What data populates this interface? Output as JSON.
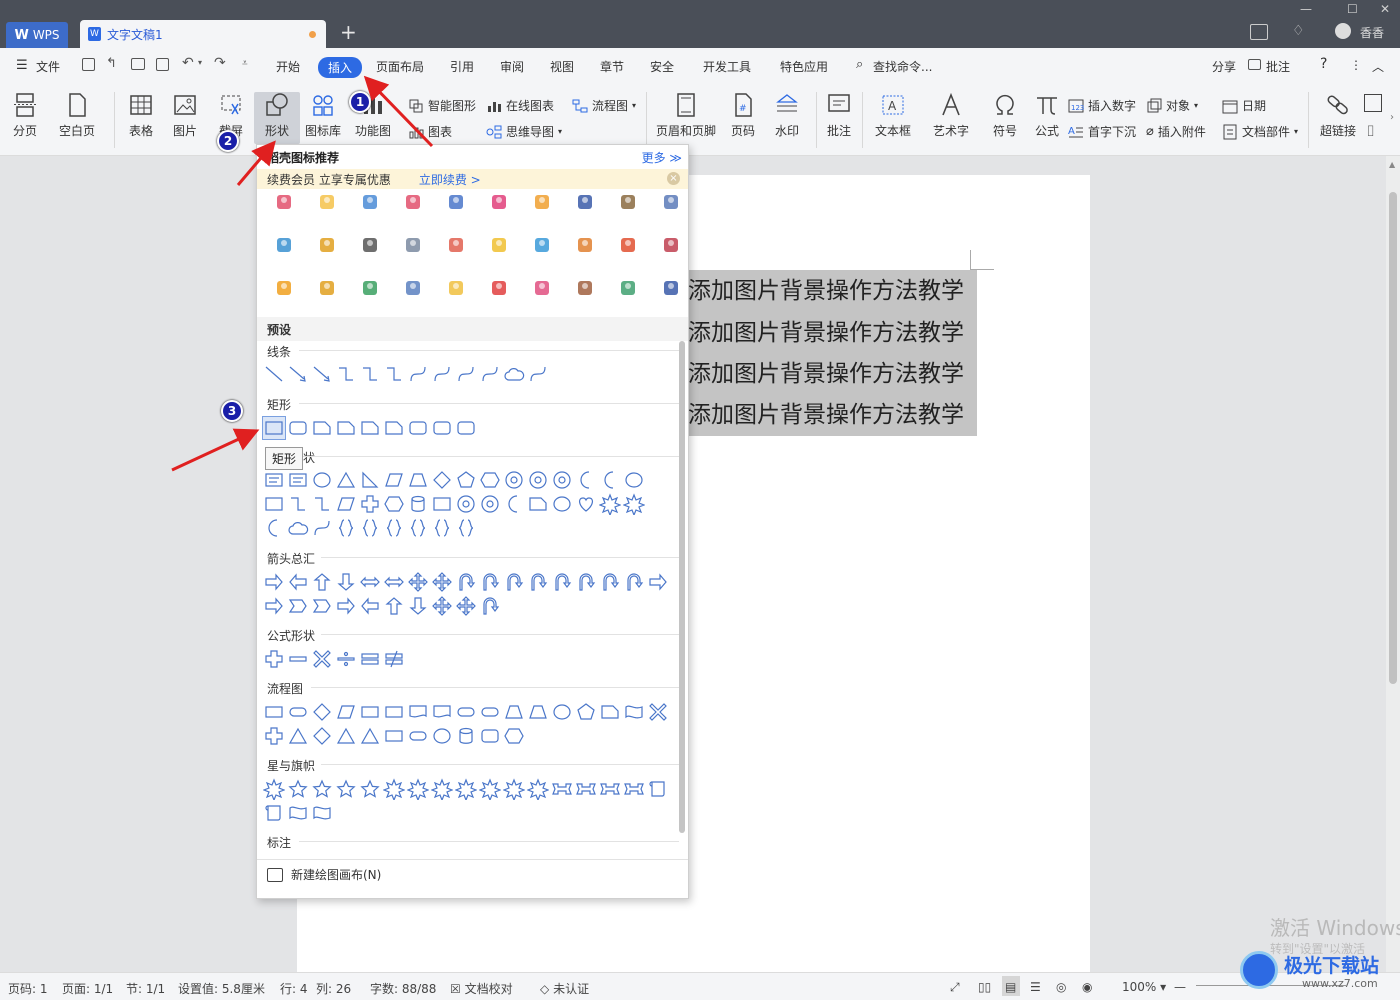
{
  "titlebar": {
    "app_button": "WPS",
    "doc_tab": "文字文稿1",
    "new_tab": "+",
    "user": "香香"
  },
  "menu": {
    "file": "文件",
    "items": [
      "开始",
      "插入",
      "页面布局",
      "引用",
      "审阅",
      "视图",
      "章节",
      "安全",
      "开发工具",
      "特色应用"
    ],
    "search": "查找命令...",
    "share": "分享",
    "comment": "批注",
    "help": "?"
  },
  "ribbon": {
    "page_break": "分页",
    "blank_page": "空白页",
    "table": "表格",
    "picture": "图片",
    "screenshot": "截屏",
    "shape": "形状",
    "icon_library": "图标库",
    "function_chart": "功能图",
    "smart_shape": "智能图形",
    "online_chart": "在线图表",
    "flowchart": "流程图",
    "chart": "图表",
    "mind_map": "思维导图",
    "header_footer": "页眉和页脚",
    "page_number": "页码",
    "watermark": "水印",
    "comment": "批注",
    "textbox": "文本框",
    "wordart": "艺术字",
    "symbol": "符号",
    "formula": "公式",
    "insert_number": "插入数字",
    "object": "对象",
    "date": "日期",
    "drop_cap": "首字下沉",
    "attachment": "插入附件",
    "doc_parts": "文档部件",
    "hyperlink": "超链接"
  },
  "document": {
    "lines": [
      "添加图片背景操作方法教学",
      "添加图片背景操作方法教学",
      "添加图片背景操作方法教学",
      "添加图片背景操作方法教学"
    ]
  },
  "dropdown": {
    "header": "稻壳图标推荐",
    "more": "更多",
    "vip_text": "续费会员 立享专属优惠",
    "vip_link": "立即续费 >",
    "preset": "预设",
    "sections": {
      "lines": "线条",
      "rectangles": "矩形",
      "basic": "基本形状",
      "arrows": "箭头总汇",
      "equation": "公式形状",
      "flow": "流程图",
      "stars": "星与旗帜",
      "callouts": "标注"
    },
    "footer": "新建绘图画布(N)",
    "tooltip": "矩形"
  },
  "status": {
    "page_code": "页码: 1",
    "pages": "页面: 1/1",
    "section": "节: 1/1",
    "setting": "设置值: 5.8厘米",
    "row": "行: 4",
    "col": "列: 26",
    "words": "字数: 88/88",
    "proofread": "文档校对",
    "cert": "未认证",
    "zoom": "100%"
  },
  "annotations": [
    "1",
    "2",
    "3"
  ],
  "watermark": {
    "activate": "激活 Windows",
    "activate_sub": "转到\"设置\"以激活",
    "site": "极光下载站",
    "url": "www.xz7.com"
  },
  "colors": {
    "accent": "#2d6ae3",
    "titlebar": "#4a4f58",
    "arrow": "#e02020",
    "badge": "#1a1fa8"
  }
}
